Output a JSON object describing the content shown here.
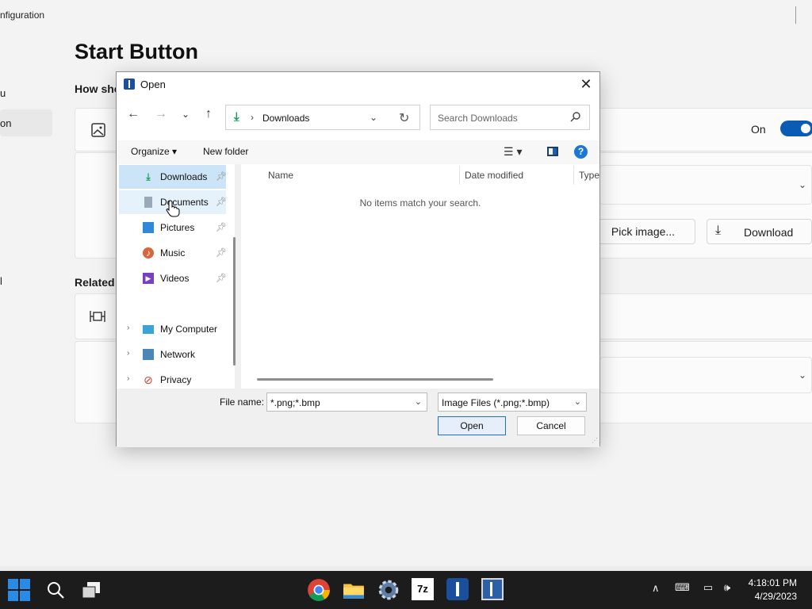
{
  "background": {
    "window_title": "nfiguration",
    "heading": "Start Button",
    "subheading": "How sho",
    "related_label": "Related",
    "nav_items": [
      "u",
      "on",
      "l"
    ],
    "toggle_label": "On",
    "pick_image_label": "Pick image...",
    "download_label": "Download"
  },
  "dialog": {
    "title": "Open",
    "address": {
      "location": "Downloads"
    },
    "search": {
      "placeholder": "Search Downloads"
    },
    "toolbar": {
      "organize": "Organize",
      "new_folder": "New folder"
    },
    "nav_pane": {
      "quick_access": [
        {
          "label": "Downloads",
          "icon": "download-icon",
          "pinned": true,
          "selected": true
        },
        {
          "label": "Documents",
          "icon": "document-icon",
          "pinned": true,
          "hover": true
        },
        {
          "label": "Pictures",
          "icon": "pictures-icon",
          "pinned": true
        },
        {
          "label": "Music",
          "icon": "music-icon",
          "pinned": true
        },
        {
          "label": "Videos",
          "icon": "videos-icon",
          "pinned": true
        }
      ],
      "locations": [
        {
          "label": "My Computer",
          "icon": "computer-icon"
        },
        {
          "label": "Network",
          "icon": "network-icon"
        },
        {
          "label": "Privacy",
          "icon": "privacy-icon"
        }
      ]
    },
    "columns": [
      "Name",
      "Date modified",
      "Type"
    ],
    "empty_message": "No items match your search.",
    "file_name_label": "File name:",
    "file_name_value": "*.png;*.bmp",
    "file_type_value": "Image Files (*.png;*.bmp)",
    "open_label": "Open",
    "cancel_label": "Cancel"
  },
  "taskbar": {
    "apps": [
      "search-icon",
      "task-view-icon",
      "chrome-icon",
      "file-explorer-icon",
      "settings-icon",
      "7zip-icon",
      "app-icon",
      "app-config-icon"
    ],
    "clock_time": "4:18:01 PM",
    "clock_date": "4/29/2023"
  },
  "colors": {
    "accent": "#0a5bb4",
    "taskbar": "#1c1c1c",
    "dialog_bg": "#f0f0f0"
  }
}
